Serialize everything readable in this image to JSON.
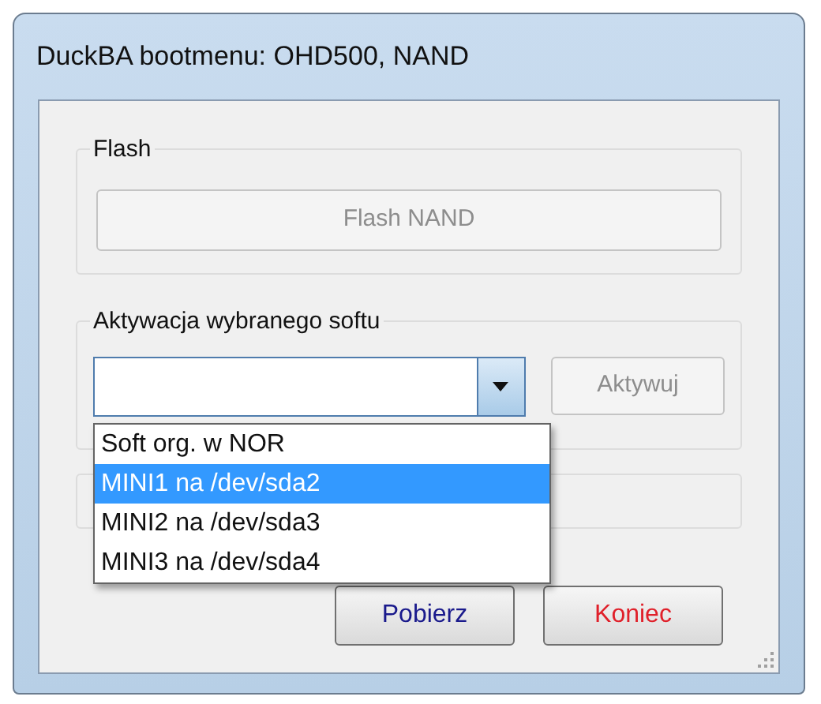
{
  "window": {
    "title": "DuckBA bootmenu: OHD500, NAND"
  },
  "flash_group": {
    "label": "Flash",
    "button": {
      "label": "Flash NAND",
      "disabled": true
    }
  },
  "activation_group": {
    "label": "Aktywacja wybranego softu",
    "combo": {
      "expanded": true,
      "options": [
        {
          "label": "Soft org. w NOR",
          "selected": false
        },
        {
          "label": "MINI1 na /dev/sda2",
          "selected": true
        },
        {
          "label": "MINI2 na /dev/sda3",
          "selected": false
        },
        {
          "label": "MINI3 na /dev/sda4",
          "selected": false
        }
      ]
    },
    "button": {
      "label": "Aktywuj",
      "disabled": true
    }
  },
  "buttons": [
    {
      "label": "Pobierz",
      "kind": "download"
    },
    {
      "label": "Koniec",
      "kind": "exit"
    }
  ]
}
